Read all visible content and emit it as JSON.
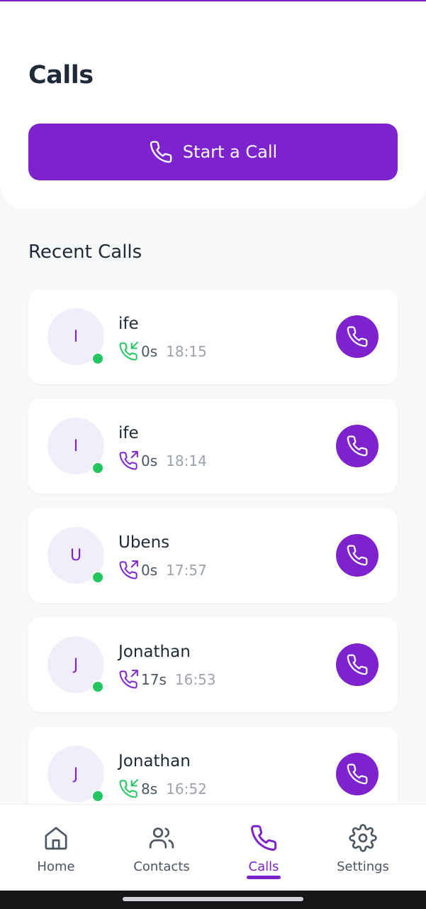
{
  "header": {
    "title": "Calls",
    "start_call_label": "Start a Call"
  },
  "recent": {
    "title": "Recent Calls",
    "calls": [
      {
        "initial": "I",
        "name": "ife",
        "direction": "incoming",
        "duration": "0s",
        "time": "18:15"
      },
      {
        "initial": "I",
        "name": "ife",
        "direction": "outgoing",
        "duration": "0s",
        "time": "18:14"
      },
      {
        "initial": "U",
        "name": "Ubens",
        "direction": "outgoing",
        "duration": "0s",
        "time": "17:57"
      },
      {
        "initial": "J",
        "name": "Jonathan",
        "direction": "outgoing",
        "duration": "17s",
        "time": "16:53"
      },
      {
        "initial": "J",
        "name": "Jonathan",
        "direction": "incoming",
        "duration": "8s",
        "time": "16:52"
      }
    ]
  },
  "nav": {
    "items": [
      {
        "label": "Home",
        "icon": "home-icon"
      },
      {
        "label": "Contacts",
        "icon": "contacts-icon"
      },
      {
        "label": "Calls",
        "icon": "phone-icon",
        "active": true
      },
      {
        "label": "Settings",
        "icon": "gear-icon"
      }
    ]
  },
  "colors": {
    "accent": "#7e22ce",
    "incoming": "#22c55e",
    "online": "#22c55e",
    "background": "#f7f8fa"
  }
}
